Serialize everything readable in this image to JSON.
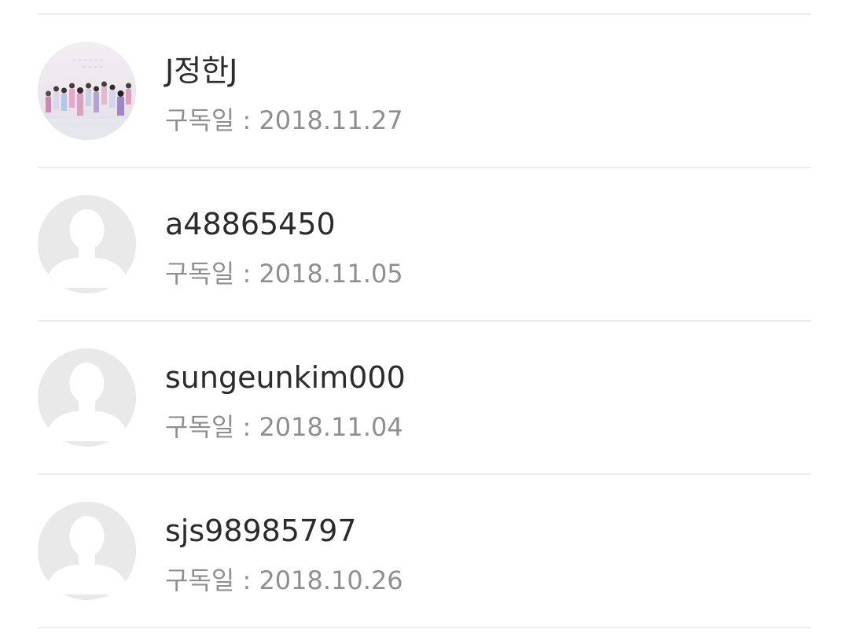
{
  "subscribers": [
    {
      "name": "J정한J",
      "date": "구독일 : 2018.11.27",
      "avatar": "group-photo-avatar"
    },
    {
      "name": "a48865450",
      "date": "구독일 : 2018.11.05",
      "avatar": "default-person-avatar"
    },
    {
      "name": "sungeunkim000",
      "date": "구독일 : 2018.11.04",
      "avatar": "default-person-avatar"
    },
    {
      "name": "sjs98985797",
      "date": "구독일 : 2018.10.26",
      "avatar": "default-person-avatar"
    }
  ],
  "colors": {
    "divider": "#ececec",
    "name_text": "#2b2b2b",
    "date_text": "#8f8f8f",
    "default_avatar_bg": "#e9e9e9",
    "default_avatar_fg": "#ffffff"
  }
}
